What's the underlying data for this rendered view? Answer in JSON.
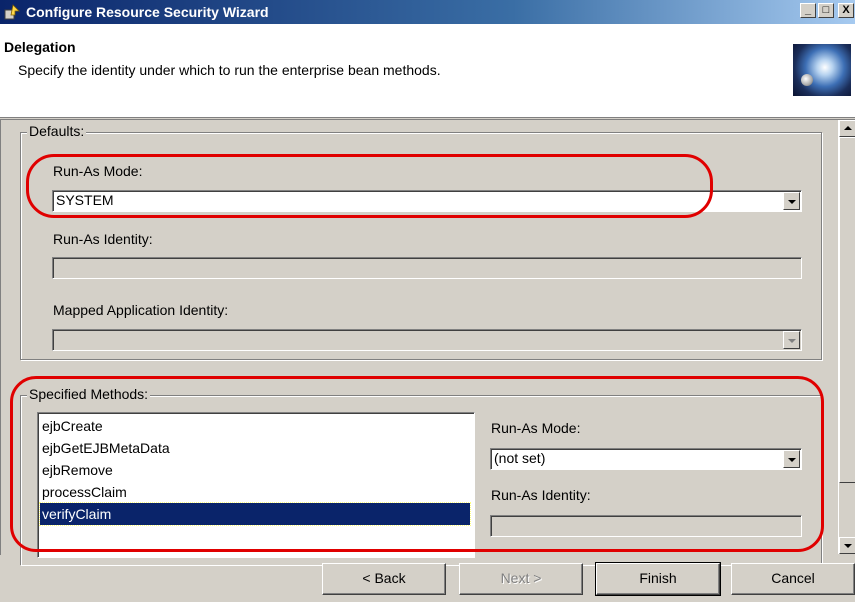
{
  "window": {
    "title": "Configure Resource Security Wizard",
    "minimize_glyph": "_",
    "maximize_glyph": "□",
    "close_glyph": "X"
  },
  "header": {
    "title": "Delegation",
    "description": "Specify the identity under which to run the enterprise bean methods."
  },
  "defaults": {
    "group_label": "Defaults:",
    "run_as_mode_label": "Run-As Mode:",
    "run_as_mode_value": "SYSTEM",
    "run_as_identity_label": "Run-As Identity:",
    "mapped_identity_label": "Mapped Application Identity:"
  },
  "specified_methods": {
    "group_label": "Specified Methods:",
    "methods": [
      "ejbCreate",
      "ejbGetEJBMetaData",
      "ejbRemove",
      "processClaim",
      "verifyClaim"
    ],
    "selected": "verifyClaim",
    "run_as_mode_label": "Run-As Mode:",
    "run_as_mode_value": "(not set)",
    "run_as_identity_label": "Run-As Identity:"
  },
  "buttons": {
    "back": "Back",
    "next": "Next",
    "finish": "Finish",
    "cancel": "Cancel"
  },
  "icons": [
    "wizard-app-icon",
    "chevron-down-icon",
    "scroll-up-icon",
    "scroll-down-icon"
  ],
  "colors": {
    "titlebar": "#0a246a",
    "selection": "#0a246a",
    "annotation": "#e00000",
    "dialog_bg": "#d4d0c8"
  }
}
